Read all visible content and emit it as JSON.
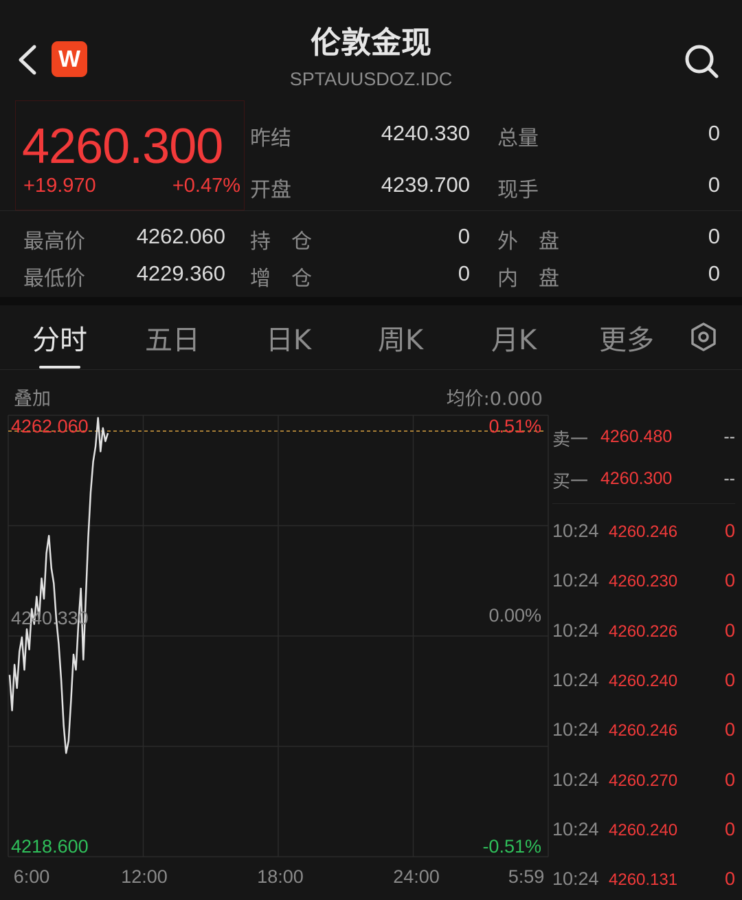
{
  "header": {
    "title": "伦敦金现",
    "subtitle": "SPTAUUSDOZ.IDC",
    "badge": "W",
    "back_icon": "chevron-left-icon",
    "search_icon": "search-icon"
  },
  "quote": {
    "price": "4260.300",
    "change": "+19.970",
    "change_pct": "+0.47%",
    "stats": [
      {
        "label": "昨结",
        "value": "4240.330"
      },
      {
        "label": "开盘",
        "value": "4239.700"
      },
      {
        "label": "总量",
        "value": "0"
      },
      {
        "label": "现手",
        "value": "0"
      },
      {
        "label": "最高价",
        "value": "4262.060"
      },
      {
        "label": "最低价",
        "value": "4229.360"
      },
      {
        "label": "持　仓",
        "value": "0"
      },
      {
        "label": "增　仓",
        "value": "0"
      },
      {
        "label": "外　盘",
        "value": "0"
      },
      {
        "label": "内　盘",
        "value": "0"
      }
    ]
  },
  "tabs": [
    "分时",
    "五日",
    "日K",
    "周K",
    "月K",
    "更多"
  ],
  "active_tab": "分时",
  "chart_header": {
    "overlay": "叠加",
    "avg": "均价:0.000"
  },
  "chart_data": {
    "type": "line",
    "y_top_label": "4262.060",
    "y_mid_label": "4240.330",
    "y_bottom_label": "4218.600",
    "pct_top": "0.51%",
    "pct_mid": "0.00%",
    "pct_bottom": "-0.51%",
    "x_labels": [
      "6:00",
      "12:00",
      "18:00",
      "24:00",
      "5:59"
    ],
    "ylim": [
      4218.6,
      4262.06
    ],
    "reference": 4240.33,
    "series": [
      {
        "values": [
          4236.5,
          4233.0,
          4237.5,
          4235.2,
          4238.8,
          4240.2,
          4237.0,
          4241.0,
          4239.0,
          4243.0,
          4241.5,
          4244.2,
          4242.0,
          4246.0,
          4244.0,
          4248.5,
          4250.2,
          4247.0,
          4245.5,
          4242.0,
          4239.5,
          4236.0,
          4231.5,
          4228.8,
          4230.0,
          4234.0,
          4238.5,
          4237.0,
          4241.5,
          4245.0,
          4238.0,
          4244.0,
          4250.0,
          4254.5,
          4257.5,
          4259.0,
          4261.8,
          4258.5,
          4260.8,
          4259.5,
          4260.3
        ]
      }
    ]
  },
  "order_book": {
    "sell": {
      "label": "卖一",
      "price": "4260.480",
      "vol": "--"
    },
    "buy": {
      "label": "买一",
      "price": "4260.300",
      "vol": "--"
    }
  },
  "ticks": [
    {
      "time": "10:24",
      "price": "4260.246",
      "vol": "0"
    },
    {
      "time": "10:24",
      "price": "4260.230",
      "vol": "0"
    },
    {
      "time": "10:24",
      "price": "4260.226",
      "vol": "0"
    },
    {
      "time": "10:24",
      "price": "4260.240",
      "vol": "0"
    },
    {
      "time": "10:24",
      "price": "4260.246",
      "vol": "0"
    },
    {
      "time": "10:24",
      "price": "4260.270",
      "vol": "0"
    },
    {
      "time": "10:24",
      "price": "4260.240",
      "vol": "0"
    },
    {
      "time": "10:24",
      "price": "4260.131",
      "vol": "0"
    }
  ]
}
